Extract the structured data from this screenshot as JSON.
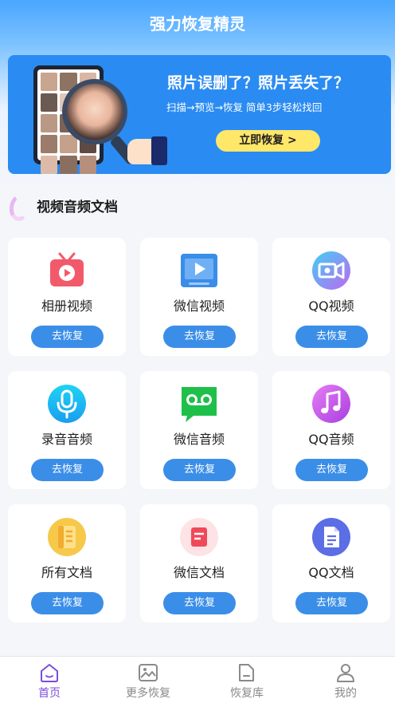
{
  "app": {
    "title": "强力恢复精灵"
  },
  "banner": {
    "title": "照片误删了？照片丢失了？",
    "subtitle": "扫描→预览→恢复  简单3步轻松找回",
    "button_label": "立即恢复 >"
  },
  "section": {
    "title": "视频音频文档"
  },
  "cards": [
    {
      "label": "相册视频",
      "button": "去恢复",
      "icon": "video-tv-icon",
      "color": "#f25a6b"
    },
    {
      "label": "微信视频",
      "button": "去恢复",
      "icon": "video-play-icon",
      "color": "#3a8de8"
    },
    {
      "label": "QQ视频",
      "button": "去恢复",
      "icon": "video-camera-icon",
      "color": "#b36ff0"
    },
    {
      "label": "录音音频",
      "button": "去恢复",
      "icon": "microphone-icon",
      "color": "#19b6f0"
    },
    {
      "label": "微信音频",
      "button": "去恢复",
      "icon": "voicemail-icon",
      "color": "#1ec04a"
    },
    {
      "label": "QQ音频",
      "button": "去恢复",
      "icon": "music-note-icon",
      "color": "#c25be8"
    },
    {
      "label": "所有文档",
      "button": "去恢复",
      "icon": "notebook-icon",
      "color": "#f5bf3a"
    },
    {
      "label": "微信文档",
      "button": "去恢复",
      "icon": "document-icon",
      "color": "#ef4a5a"
    },
    {
      "label": "QQ文档",
      "button": "去恢复",
      "icon": "file-text-icon",
      "color": "#5b6ee6"
    }
  ],
  "tabs": [
    {
      "label": "首页",
      "icon": "home-icon",
      "active": true
    },
    {
      "label": "更多恢复",
      "icon": "image-icon",
      "active": false
    },
    {
      "label": "恢复库",
      "icon": "folder-icon",
      "active": false
    },
    {
      "label": "我的",
      "icon": "user-icon",
      "active": false
    }
  ],
  "colors": {
    "primary": "#3b8ee8",
    "banner": "#2a8bf2",
    "accent_yellow": "#ffe769",
    "active_tab": "#7b4ddb"
  }
}
